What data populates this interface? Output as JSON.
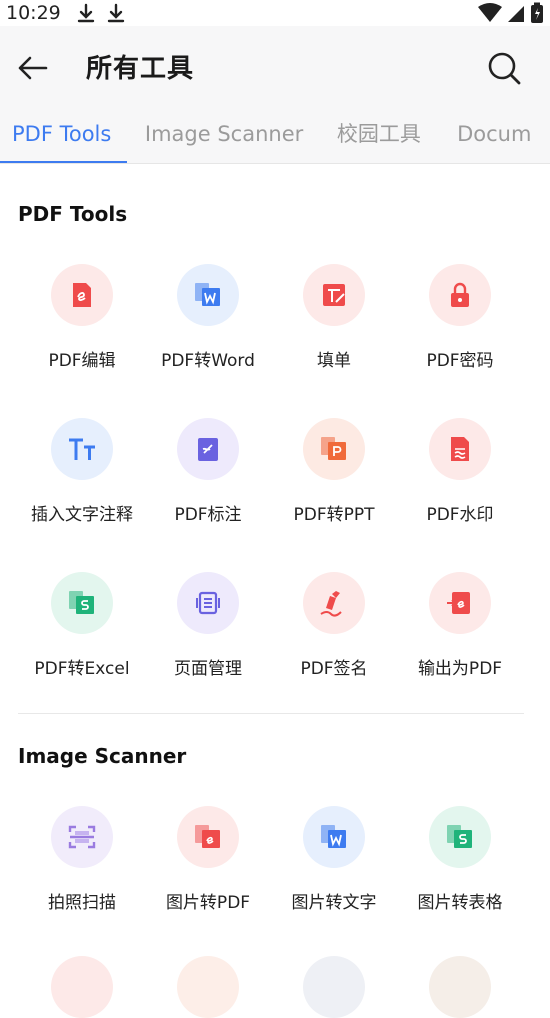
{
  "status_bar": {
    "time": "10:29"
  },
  "app_bar": {
    "title": "所有工具"
  },
  "tabs": [
    {
      "label": "PDF Tools"
    },
    {
      "label": "Image Scanner"
    },
    {
      "label": "校园工具"
    },
    {
      "label": "Docum"
    }
  ],
  "sections": [
    {
      "title": "PDF Tools",
      "items": [
        {
          "label": "PDF编辑",
          "icon": "pdf-edit-icon"
        },
        {
          "label": "PDF转Word",
          "icon": "pdf-to-word-icon"
        },
        {
          "label": "填单",
          "icon": "fill-form-icon"
        },
        {
          "label": "PDF密码",
          "icon": "lock-icon"
        },
        {
          "label": "插入文字注释",
          "icon": "text-annotation-icon"
        },
        {
          "label": "PDF标注",
          "icon": "pdf-markup-icon"
        },
        {
          "label": "PDF转PPT",
          "icon": "pdf-to-ppt-icon"
        },
        {
          "label": "PDF水印",
          "icon": "watermark-icon"
        },
        {
          "label": "PDF转Excel",
          "icon": "pdf-to-excel-icon"
        },
        {
          "label": "页面管理",
          "icon": "page-manage-icon"
        },
        {
          "label": "PDF签名",
          "icon": "signature-pen-icon"
        },
        {
          "label": "输出为PDF",
          "icon": "export-pdf-icon"
        }
      ]
    },
    {
      "title": "Image Scanner",
      "items": [
        {
          "label": "拍照扫描",
          "icon": "scan-camera-icon"
        },
        {
          "label": "图片转PDF",
          "icon": "image-to-pdf-icon"
        },
        {
          "label": "图片转文字",
          "icon": "image-to-text-icon"
        },
        {
          "label": "图片转表格",
          "icon": "image-to-table-icon"
        }
      ]
    }
  ],
  "colors": {
    "accent": "#3d7bf0",
    "red": "#ef4b4b",
    "blue": "#3d7bf0",
    "purple": "#6a62e0",
    "orange": "#f06a3a",
    "green": "#1fb37a"
  }
}
